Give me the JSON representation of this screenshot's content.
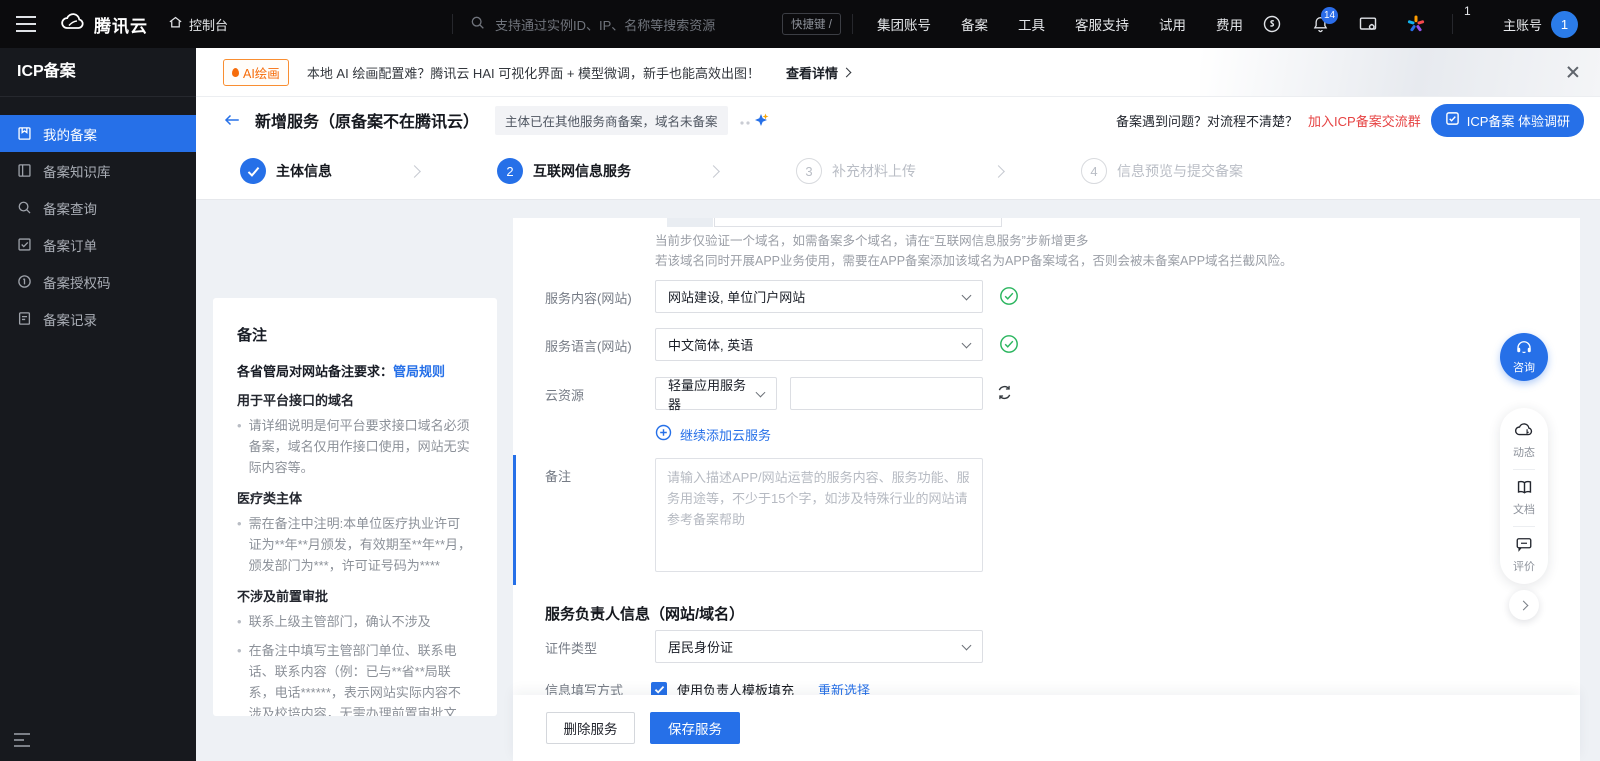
{
  "colors": {
    "accent_blue": "#2670e8",
    "success_green": "#2ab55e",
    "alert_red": "#e64343",
    "brand_orange": "#f66c0a",
    "topbar_bg": "#0b0b0d",
    "sidebar_bg": "#17191e",
    "page_bg": "#eef1f5"
  },
  "topbar": {
    "logo_text": "腾讯云",
    "console_label": "控制台",
    "search_placeholder": "支持通过实例ID、IP、名称等搜索资源",
    "shortcut_label": "快捷键 /",
    "menu": [
      "集团账号",
      "备案",
      "工具",
      "客服支持",
      "试用",
      "费用"
    ],
    "bell_badge": "14",
    "corner_badge": "1",
    "account_label": "主账号",
    "avatar_text": "1"
  },
  "sidebar": {
    "title": "ICP备案",
    "items": [
      {
        "label": "我的备案",
        "active": true
      },
      {
        "label": "备案知识库",
        "active": false
      },
      {
        "label": "备案查询",
        "active": false
      },
      {
        "label": "备案订单",
        "active": false
      },
      {
        "label": "备案授权码",
        "active": false
      },
      {
        "label": "备案记录",
        "active": false
      }
    ]
  },
  "banner": {
    "tag": "AI绘画",
    "text": "本地 AI 绘画配置难？腾讯云 HAI 可视化界面 + 模型微调，新手也能高效出图！",
    "link": "查看详情"
  },
  "page_header": {
    "title": "新增服务（原备案不在腾讯云）",
    "badge": "主体已在其他服务商备案，域名未备案",
    "help_text": "备案遇到问题？对流程不清楚？",
    "help_link": "加入ICP备案交流群",
    "survey_button": "ICP备案 体验调研"
  },
  "stepper": {
    "steps": [
      {
        "num": "1",
        "label": "主体信息",
        "state": "done"
      },
      {
        "num": "2",
        "label": "互联网信息服务",
        "state": "current"
      },
      {
        "num": "3",
        "label": "补充材料上传",
        "state": "todo"
      },
      {
        "num": "4",
        "label": "信息预览与提交备案",
        "state": "todo"
      }
    ]
  },
  "notes_panel": {
    "title": "备注",
    "intro_label": "各省管局对网站备注要求：",
    "intro_link": "管局规则",
    "sections": [
      {
        "heading": "用于平台接口的域名",
        "bullets": [
          "请详细说明是何平台要求接口域名必须备案，域名仅用作接口使用，网站无实际内容等。"
        ]
      },
      {
        "heading": "医疗类主体",
        "bullets": [
          "需在备注中注明:本单位医疗执业许可证为**年**月颁发，有效期至**年**月，颁发部门为***，许可证号码为****"
        ]
      },
      {
        "heading": "不涉及前置审批",
        "bullets": [
          "联系上级主管部门，确认不涉及",
          "在备注中填写主管部门单位、联系电话、联系内容（例：已与**省**局联系，电话******，表示网站实际内容不涉及校培内容，无需办理前置审批文件）"
        ]
      }
    ]
  },
  "form": {
    "tip_line1": "当前步仅验证一个域名，如需备案多个域名，请在“互联网信息服务”步新增更多",
    "tip_line2": "若该域名同时开展APP业务使用，需要在APP备案添加该域名为APP备案域名，否则会被未备案APP域名拦截风险。",
    "service_content": {
      "label": "服务内容(网站)",
      "value": "网站建设, 单位门户网站"
    },
    "service_language": {
      "label": "服务语言(网站)",
      "value": "中文简体, 英语"
    },
    "cloud_resource": {
      "label": "云资源",
      "select_value": "轻量应用服务器",
      "input_value": ""
    },
    "add_cloud_link": "继续添加云服务",
    "remark": {
      "label": "备注",
      "placeholder": "请输入描述APP/网站运营的服务内容、服务功能、服务用途等，不少于15个字，如涉及特殊行业的网站请参考备案帮助"
    },
    "owner_section_title": "服务负责人信息（网站/域名）",
    "cert_type": {
      "label": "证件类型",
      "value": "居民身份证"
    },
    "fill_mode": {
      "label": "信息填写方式",
      "checkbox_label": "使用负责人模板填充",
      "link": "重新选择"
    }
  },
  "footer": {
    "delete_button": "删除服务",
    "save_button": "保存服务"
  },
  "float_panel": {
    "consult": "咨询",
    "items": [
      {
        "label": "动态"
      },
      {
        "label": "文档"
      },
      {
        "label": "评价"
      }
    ]
  }
}
